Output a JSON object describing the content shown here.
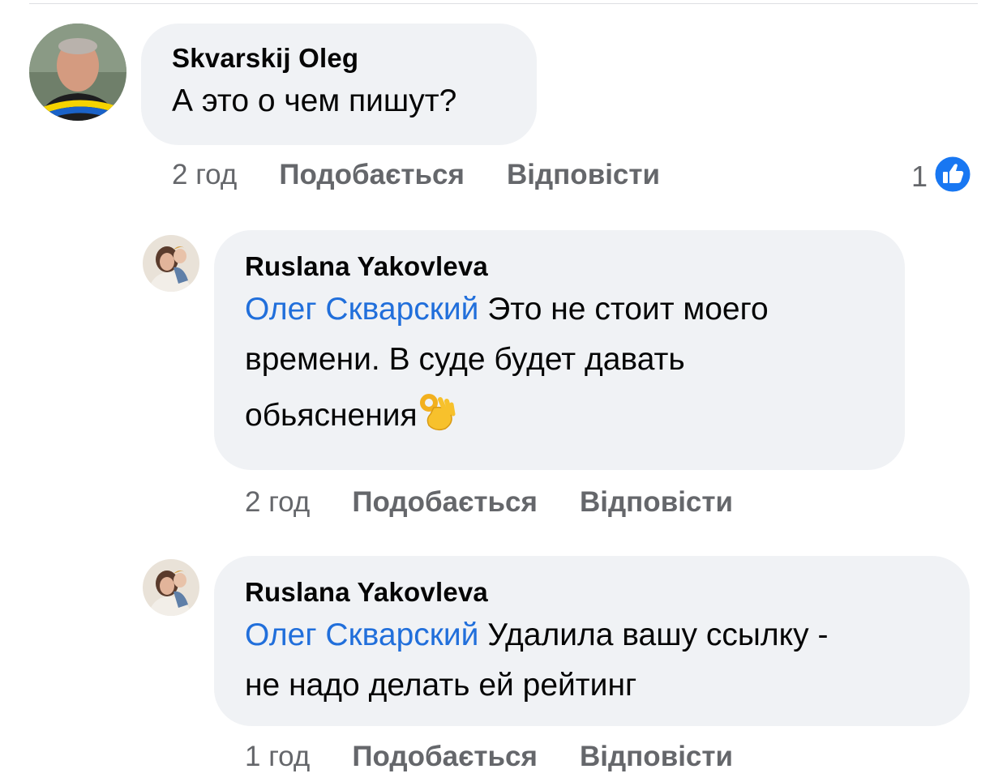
{
  "comments": [
    {
      "author": "Skvarskij Oleg",
      "text": "А это о чем пишут?",
      "time": "2 год",
      "like_label": "Подобається",
      "reply_label": "Відповісти",
      "reaction_count": "1",
      "reaction_icon": "like-icon"
    },
    {
      "author": "Ruslana Yakovleva",
      "mention": "Олег Скварский",
      "text_line1": " Это не стоит моего",
      "text_line2": "времени. В суде будет давать",
      "text_line3": "обьяснения",
      "emoji": "ok-hand-icon",
      "time": "2 год",
      "like_label": "Подобається",
      "reply_label": "Відповісти"
    },
    {
      "author": "Ruslana Yakovleva",
      "mention": "Олег Скварский",
      "text_line1": " Удалила вашу ссылку -",
      "text_line2": "не надо делать ей рейтинг",
      "time": "1 год",
      "like_label": "Подобається",
      "reply_label": "Відповісти"
    }
  ],
  "colors": {
    "bubble": "#f0f2f5",
    "mention": "#216fdb",
    "meta": "#65676b",
    "like_badge": "#1877f2"
  }
}
